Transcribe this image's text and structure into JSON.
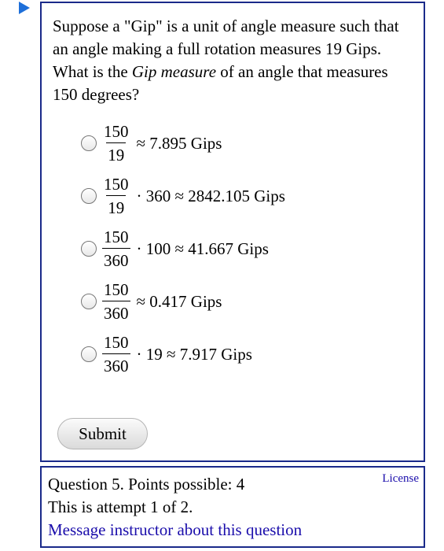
{
  "question": {
    "text_before": "Suppose a \"Gip\" is a unit of angle measure such that an angle making a full rotation measures 19 Gips. What is the ",
    "text_italic": "Gip measure",
    "text_after": " of an angle that measures 150 degrees?"
  },
  "choices": [
    {
      "numerator": "150",
      "denominator": "19",
      "rest": "≈ 7.895 Gips"
    },
    {
      "numerator": "150",
      "denominator": "19",
      "rest": "· 360 ≈ 2842.105 Gips"
    },
    {
      "numerator": "150",
      "denominator": "360",
      "rest": "· 100 ≈ 41.667 Gips"
    },
    {
      "numerator": "150",
      "denominator": "360",
      "rest": "≈ 0.417 Gips"
    },
    {
      "numerator": "150",
      "denominator": "360",
      "rest": "· 19 ≈ 7.917 Gips"
    }
  ],
  "submit_label": "Submit",
  "info": {
    "line1": "Question 5. Points possible: 4",
    "line2": "This is attempt 1 of 2.",
    "message_link": "Message instructor about this question",
    "license_link": "License"
  },
  "colors": {
    "border": "#1a2a8a",
    "link": "#1a0dab",
    "arrow": "#1e6fd9"
  },
  "icons": {
    "question-marker": "play-arrow-icon"
  }
}
